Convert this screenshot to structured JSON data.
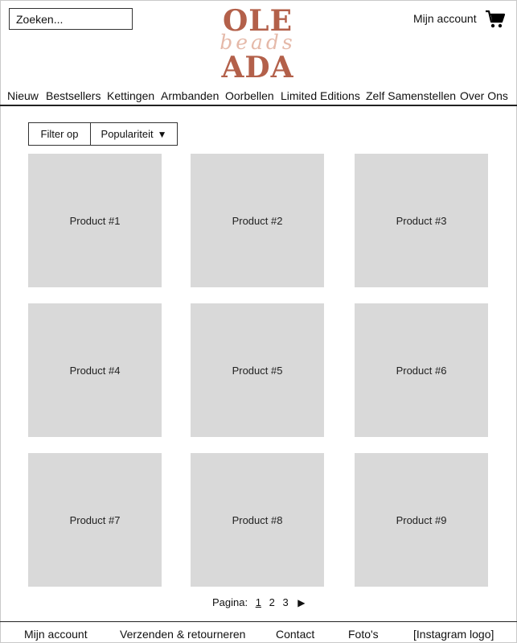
{
  "header": {
    "search_placeholder": "Zoeken...",
    "account_label": "Mijn account",
    "cart_icon": "shopping-cart-icon"
  },
  "logo": {
    "line1": "OLE",
    "line2": "beads",
    "line3": "ADA",
    "color_primary": "#b3604a",
    "color_secondary": "#e5b9a9"
  },
  "nav": {
    "items": [
      "Nieuw",
      "Bestsellers",
      "Kettingen",
      "Armbanden",
      "Oorbellen",
      "Limited Editions",
      "Zelf Samenstellen",
      "Over Ons"
    ]
  },
  "filter": {
    "label": "Filter op",
    "sort_value": "Populariteit",
    "sort_icon": "triangle-down-icon"
  },
  "products": [
    {
      "label": "Product #1"
    },
    {
      "label": "Product #2"
    },
    {
      "label": "Product #3"
    },
    {
      "label": "Product #4"
    },
    {
      "label": "Product #5"
    },
    {
      "label": "Product #6"
    },
    {
      "label": "Product #7"
    },
    {
      "label": "Product #8"
    },
    {
      "label": "Product #9"
    }
  ],
  "pagination": {
    "label": "Pagina:",
    "pages": [
      "1",
      "2",
      "3"
    ],
    "current": "1",
    "next_icon": "triangle-right-icon"
  },
  "footer": {
    "items": [
      "Mijn account",
      "Verzenden & retourneren",
      "Contact",
      "Foto's",
      "[Instagram logo]"
    ]
  },
  "colors": {
    "tile_background": "#d9d9d9",
    "border": "#222222"
  }
}
